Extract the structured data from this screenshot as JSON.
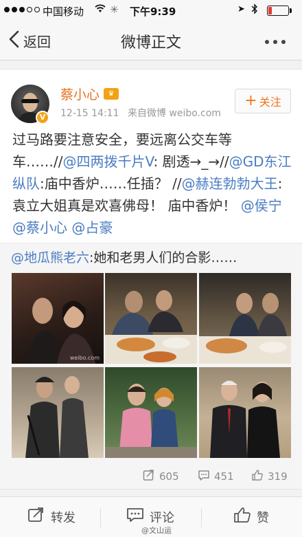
{
  "status_bar": {
    "carrier": "中国移动",
    "time": "下午9:39",
    "signal_dots_filled": 3,
    "signal_dots_total": 5,
    "battery_level": 0.15,
    "icons": [
      "wifi-icon",
      "loading-icon",
      "location-icon",
      "bluetooth-icon",
      "battery-icon"
    ]
  },
  "nav": {
    "back_label": "返回",
    "title": "微博正文"
  },
  "post": {
    "author": "蔡小心",
    "timestamp": "12-15 14:11",
    "source": "来自微博 weibo.com",
    "verified_badge": "V",
    "follow_label": "关注",
    "text_plain_1": "过马路要注意安全，要远离公交车等车……//",
    "mention_1": "@四两拨千片V",
    "text_plain_2": ": 剧透→_→//",
    "mention_2": "@GD东江纵队",
    "text_plain_3": ":庙中香炉……任插？ //",
    "mention_3": "@赫连勃勃大王",
    "text_plain_4": ":袁立大姐真是欢喜佛母！ 庙中香炉！ ",
    "mention_4": "@侯宁",
    "mention_5": "@蔡小心",
    "mention_6": "@占豪"
  },
  "retweet": {
    "mention": "@地瓜熊老六",
    "text": ":她和老男人们的合影……",
    "photo_watermark": "weibo.com"
  },
  "stats": {
    "reposts": "605",
    "comments": "451",
    "likes": "319"
  },
  "toolbar": {
    "repost_label": "转发",
    "comment_label": "评论",
    "like_label": "赞"
  },
  "watermark": "@文山运",
  "colors": {
    "link": "#4a7cc3",
    "username": "#e6711e",
    "follow": "#f2741c",
    "badge": "#f3a216",
    "battery_low": "#e23a2e"
  }
}
